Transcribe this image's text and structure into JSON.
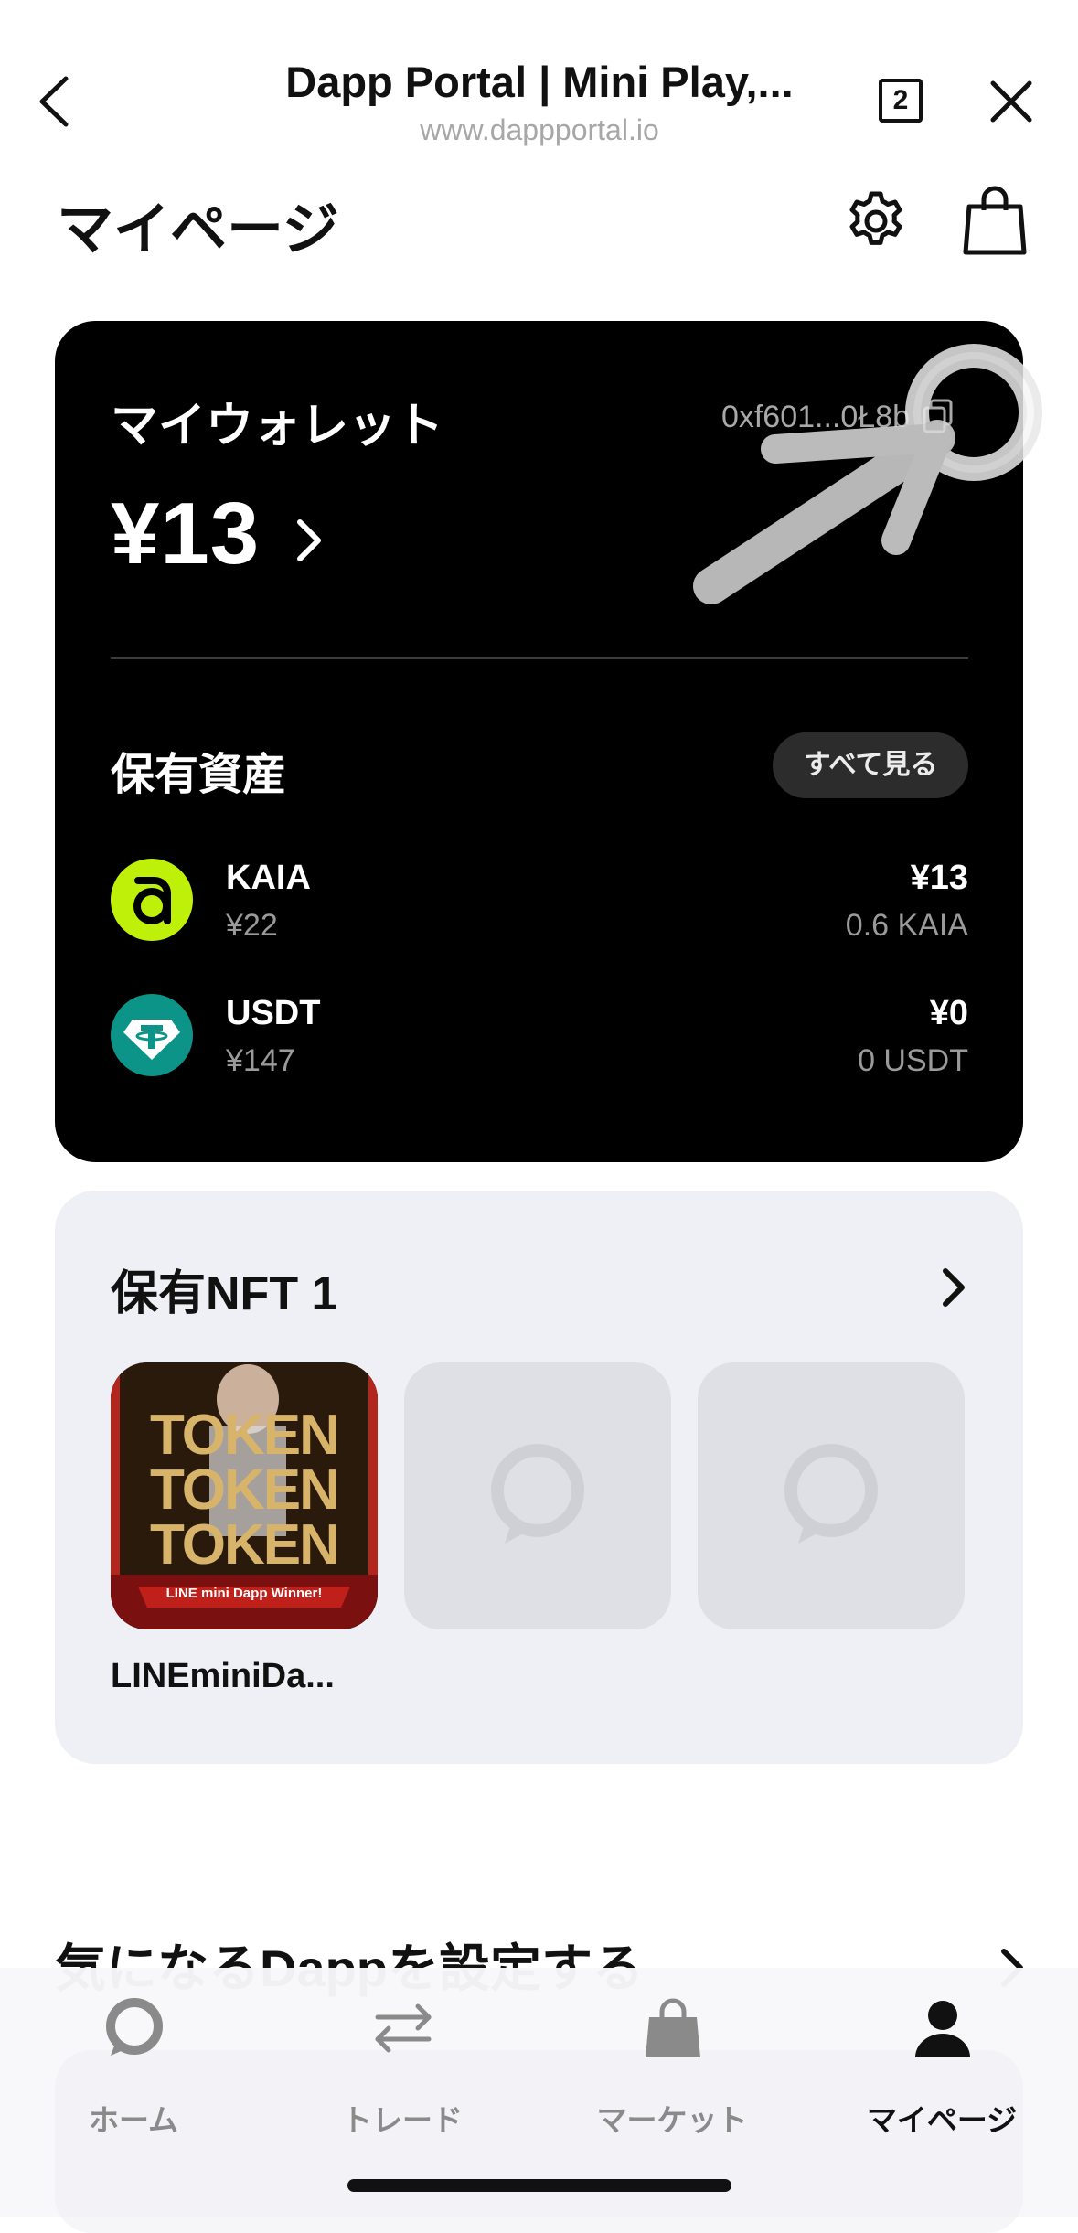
{
  "browser": {
    "title": "Dapp Portal | Mini Play,...",
    "url": "www.dappportal.io",
    "tab_count": "2"
  },
  "page": {
    "title": "マイページ"
  },
  "wallet": {
    "title": "マイウォレット",
    "address": "0xf601...0Ł8b",
    "balance": "¥13",
    "assets_title": "保有資産",
    "see_all": "すべて見る",
    "assets": [
      {
        "name": "KAIA",
        "price": "¥22",
        "value": "¥13",
        "amount": "0.6 KAIA",
        "icon": "kaia-icon",
        "color": "#bff009"
      },
      {
        "name": "USDT",
        "price": "¥147",
        "value": "¥0",
        "amount": "0 USDT",
        "icon": "tether-icon",
        "color": "#0d9488"
      }
    ]
  },
  "nft": {
    "title": "保有NFT 1",
    "items": [
      {
        "name": "LINEminiDa...",
        "image_text": [
          "TOKEN",
          "TOKEN",
          "TOKEN"
        ],
        "banner": "LINE mini Dapp Winner!"
      }
    ]
  },
  "favorites": {
    "title": "気になるDappを設定する"
  },
  "nav": [
    {
      "label": "ホーム",
      "icon": "home-icon"
    },
    {
      "label": "トレード",
      "icon": "trade-icon"
    },
    {
      "label": "マーケット",
      "icon": "market-icon"
    },
    {
      "label": "マイページ",
      "icon": "user-icon",
      "active": true
    }
  ]
}
